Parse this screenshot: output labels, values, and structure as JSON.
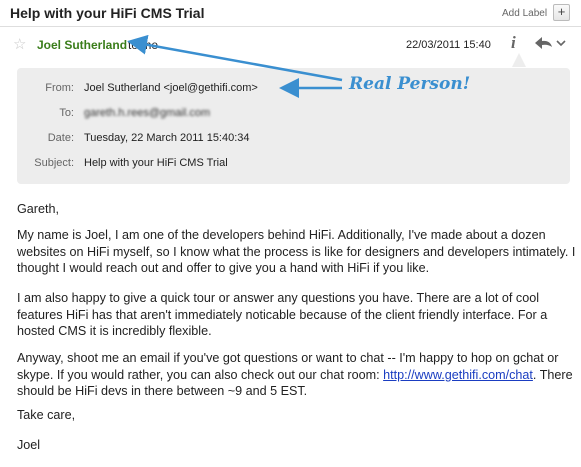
{
  "header": {
    "subject": "Help with your HiFi CMS Trial",
    "add_label": "Add Label",
    "plus": "+"
  },
  "message": {
    "sender_name": "Joel Sutherland",
    "to_me": "to me",
    "date_short": "22/03/2011 15:40",
    "info_icon": "i"
  },
  "details": {
    "from_label": "From:",
    "from_value": "Joel Sutherland <joel@gethifi.com>",
    "to_label": "To:",
    "to_value": "gareth.h.rees@gmail.com",
    "date_label": "Date:",
    "date_value": "Tuesday, 22 March 2011 15:40:34",
    "subject_label": "Subject:",
    "subject_value": "Help with your HiFi CMS Trial"
  },
  "annotation": {
    "callout": "Real Person!"
  },
  "body": {
    "greeting": "Gareth,",
    "p1": "My name is Joel, I am one of the developers behind HiFi. Additionally, I've made about a dozen websites on HiFi myself, so I know what the process is like for designers and developers intimately. I thought I would reach out and offer to give you a hand with HiFi if you like.",
    "p2": "I am also happy to give a quick tour or answer any questions you have. There are a lot of cool features HiFi has that aren't immediately noticable because of the client friendly interface. For a hosted CMS it is incredibly flexible.",
    "p3_a": "Anyway, shoot me an email if you've got questions or want to chat -- I'm happy to hop on gchat or skype. If you would rather, you can also check out our chat room:",
    "p3_link": "http://www.gethifi.com/chat",
    "p3_b": ". There should be HiFi devs in there between ~9 and 5 EST.",
    "closing": "Take care,",
    "signature": "Joel"
  },
  "colors": {
    "sender_green": "#3a7d1a",
    "callout_blue": "#3a8fd0",
    "link_blue": "#1a3dc1",
    "details_bg": "#ededed"
  },
  "icons": [
    "star-icon",
    "info-icon",
    "reply-arrow-icon",
    "dropdown-chevron-icon",
    "plus-icon"
  ]
}
